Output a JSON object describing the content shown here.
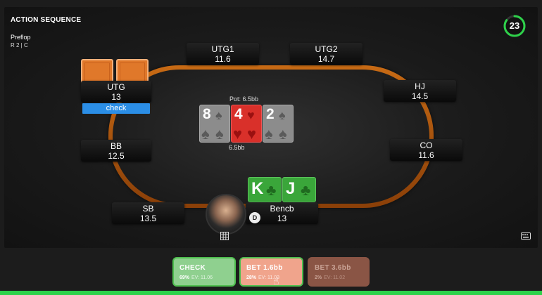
{
  "header": {
    "title": "ACTION SEQUENCE",
    "street": "Preflop",
    "line": "R 2  |  C"
  },
  "timer": {
    "value": "23",
    "fraction": 0.85,
    "color": "#2ed14a"
  },
  "seats": {
    "utg1": {
      "name": "UTG1",
      "stack": "11.6"
    },
    "utg2": {
      "name": "UTG2",
      "stack": "14.7"
    },
    "utg": {
      "name": "UTG",
      "stack": "13",
      "action": "check"
    },
    "hj": {
      "name": "HJ",
      "stack": "14.5"
    },
    "bb": {
      "name": "BB",
      "stack": "12.5"
    },
    "co": {
      "name": "CO",
      "stack": "11.6"
    },
    "sb": {
      "name": "SB",
      "stack": "13.5"
    },
    "hero": {
      "name": "Bencb",
      "stack": "13"
    }
  },
  "pot": {
    "label": "Pot: 6.5bb",
    "bets": "6.5bb"
  },
  "board": [
    {
      "rank": "8",
      "suit": "spade"
    },
    {
      "rank": "4",
      "suit": "heart"
    },
    {
      "rank": "2",
      "suit": "spade"
    }
  ],
  "hero_cards": [
    {
      "rank": "K",
      "suit": "club"
    },
    {
      "rank": "J",
      "suit": "club"
    }
  ],
  "dealer_button": "D",
  "actions": [
    {
      "label": "CHECK",
      "freq": "69%",
      "ev": "EV: 11.06"
    },
    {
      "label": "BET 1.6bb",
      "freq": "28%",
      "ev": "EV: 11.03"
    },
    {
      "label": "BET 3.6bb",
      "freq": "2%",
      "ev": "EV: 11.02"
    }
  ],
  "colors": {
    "check": "#8fd08f",
    "bet_small": "#f0a48c",
    "bet_big": "#8a5545",
    "accent": "#2ed14a",
    "action_badge": "#2b8ee6"
  }
}
